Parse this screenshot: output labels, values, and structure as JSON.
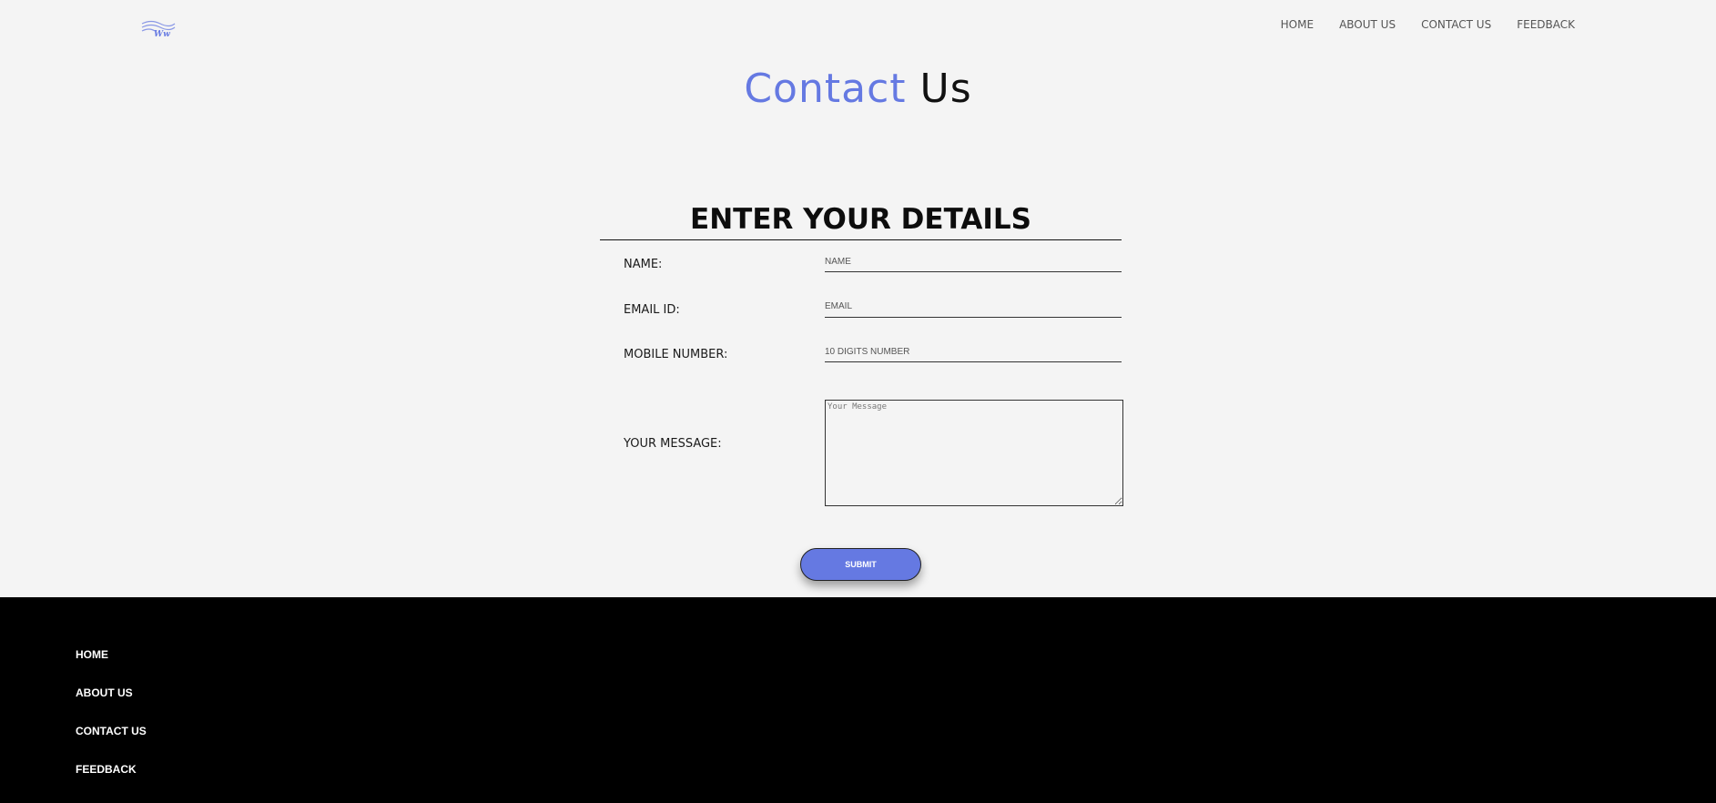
{
  "header": {
    "logo_text": "Ww",
    "nav": [
      "HOME",
      "ABOUT US",
      "CONTACT US",
      "FEEDBACK"
    ]
  },
  "title": {
    "accent": "Contact",
    "rest": "Us"
  },
  "form": {
    "heading": "ENTER YOUR DETAILS",
    "fields": [
      {
        "label": "NAME:",
        "placeholder": "NAME"
      },
      {
        "label": "EMAIL ID:",
        "placeholder": "EMAIL"
      },
      {
        "label": "MOBILE NUMBER:",
        "placeholder": "10 DIGITS NUMBER"
      }
    ],
    "message": {
      "label": "YOUR MESSAGE:",
      "placeholder": "Your Message"
    },
    "submit_label": "SUBMIT"
  },
  "footer": {
    "links": [
      "HOME",
      "ABOUT US",
      "CONTACT US",
      "FEEDBACK"
    ]
  },
  "colors": {
    "accent": "#6579e2",
    "background": "#f4f4f4",
    "footer": "#000000"
  }
}
